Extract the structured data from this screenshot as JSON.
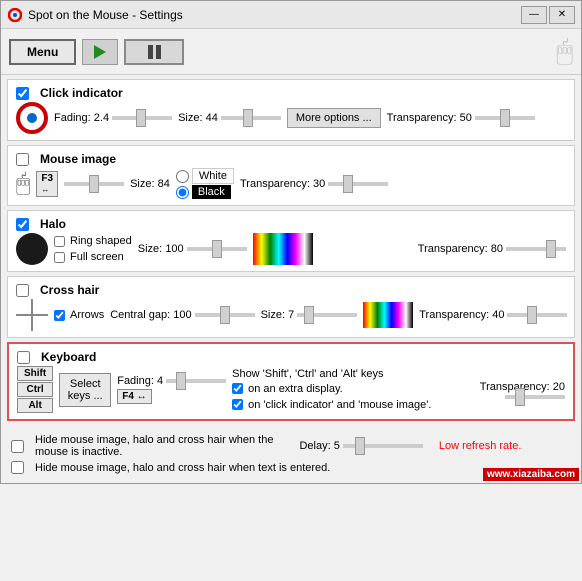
{
  "window": {
    "title": "Spot on the Mouse - Settings"
  },
  "toolbar": {
    "menu_label": "Menu",
    "pause_label": "II"
  },
  "sections": {
    "click_indicator": {
      "title": "Click indicator",
      "checked": true,
      "fading_label": "Fading:",
      "fading_value": "2.4",
      "size_label": "Size:",
      "size_value": "44",
      "more_options_label": "More options ...",
      "transparency_label": "Transparency:",
      "transparency_value": "50"
    },
    "mouse_image": {
      "title": "Mouse image",
      "checked": false,
      "size_label": "Size:",
      "size_value": "84",
      "color_white": "White",
      "color_black": "Black",
      "transparency_label": "Transparency:",
      "transparency_value": "30"
    },
    "halo": {
      "title": "Halo",
      "checked": true,
      "ring_shaped_label": "Ring shaped",
      "full_screen_label": "Full screen",
      "size_label": "Size:",
      "size_value": "100",
      "transparency_label": "Transparency:",
      "transparency_value": "80"
    },
    "cross_hair": {
      "title": "Cross hair",
      "checked": false,
      "arrows_label": "Arrows",
      "arrows_checked": true,
      "central_gap_label": "Central gap:",
      "central_gap_value": "100",
      "size_label": "Size:",
      "size_value": "7",
      "transparency_label": "Transparency:",
      "transparency_value": "40"
    },
    "keyboard": {
      "title": "Keyboard",
      "checked": false,
      "shift_label": "Shift",
      "ctrl_label": "Ctrl",
      "alt_label": "Alt",
      "select_keys_label": "Select keys ...",
      "fading_label": "Fading:",
      "fading_value": "4",
      "show_keys_label": "Show 'Shift', 'Ctrl' and 'Alt' keys",
      "extra_display_label": "on an extra display.",
      "extra_display_checked": true,
      "click_indicator_label": "on 'click indicator' and 'mouse image'.",
      "click_indicator_checked": true,
      "transparency_label": "Transparency:",
      "transparency_value": "20"
    }
  },
  "bottom": {
    "hide_inactive_label": "Hide mouse image, halo and cross hair when the",
    "hide_inactive_label2": "mouse is inactive.",
    "hide_inactive_checked": false,
    "delay_label": "Delay:",
    "delay_value": "5",
    "low_refresh_label": "Low refresh rate.",
    "hide_text_label": "Hide mouse image, halo and cross hair when text is entered.",
    "hide_text_checked": false
  },
  "title_buttons": {
    "minimize": "—",
    "close": "✕"
  }
}
